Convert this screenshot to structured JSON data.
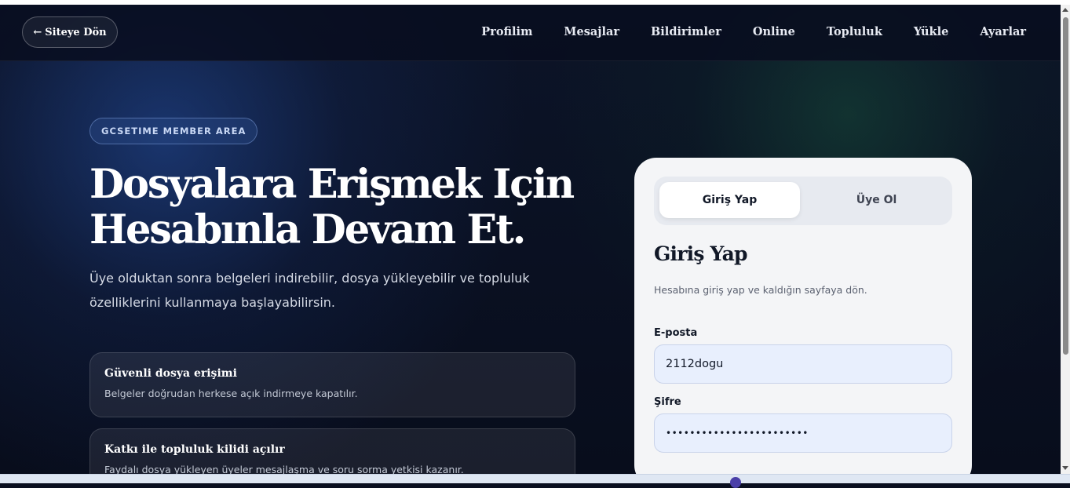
{
  "nav": {
    "back_label": "Siteye Dön",
    "items": [
      "Profilim",
      "Mesajlar",
      "Bildirimler",
      "Online",
      "Topluluk",
      "Yükle",
      "Ayarlar"
    ]
  },
  "hero": {
    "badge": "GCSETIME MEMBER AREA",
    "title_line1": "Dosyalara Erişmek Için",
    "title_line2": "Hesabınla Devam Et.",
    "description": "Üye olduktan sonra belgeleri indirebilir, dosya yükleyebilir ve topluluk özelliklerini kullanmaya başlayabilirsin."
  },
  "features": [
    {
      "title": "Güvenli dosya erişimi",
      "desc": "Belgeler doğrudan herkese açık indirmeye kapatılır."
    },
    {
      "title": "Katkı ile topluluk kilidi açılır",
      "desc": "Faydalı dosya yükleyen üyeler mesajlaşma ve soru sorma yetkisi kazanır."
    }
  ],
  "auth": {
    "tab_login": "Giriş Yap",
    "tab_register": "Üye Ol",
    "title": "Giriş Yap",
    "subtitle": "Hesabına giriş yap ve kaldığın sayfaya dön.",
    "email_label": "E-posta",
    "email_value": "2112dogu",
    "password_label": "Şifre",
    "password_value": "••••••••••••••••••••••••"
  },
  "colors": {
    "background": "#0a0f1f",
    "card": "#f4f5f7",
    "input_bg": "#e8effd",
    "primary": "#2a56c6"
  }
}
